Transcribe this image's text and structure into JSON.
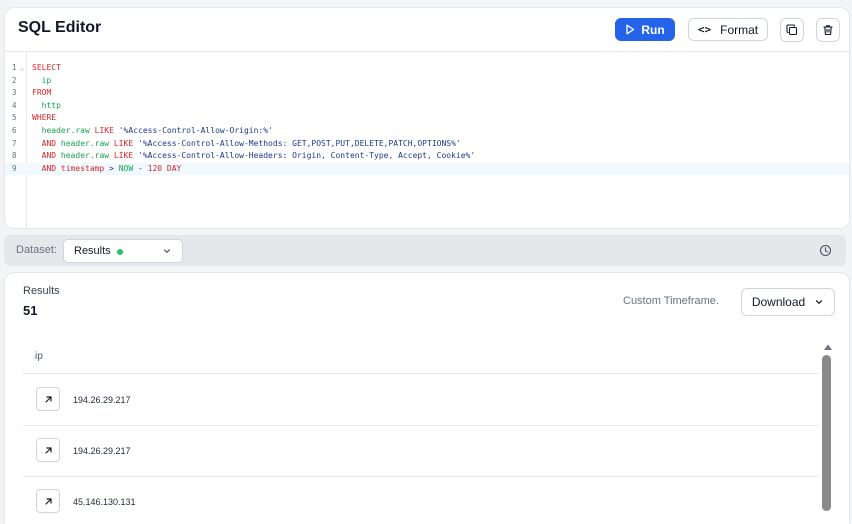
{
  "editor": {
    "title": "SQL Editor",
    "run_label": "Run",
    "format_label": "Format",
    "format_icon": "<>",
    "lines": [
      {
        "num": "1",
        "tokens": [
          {
            "t": "SELECT",
            "c": "kw"
          }
        ]
      },
      {
        "num": "2",
        "tokens": [
          {
            "t": "  ",
            "c": ""
          },
          {
            "t": "ip",
            "c": "id"
          }
        ]
      },
      {
        "num": "3",
        "tokens": [
          {
            "t": "FROM",
            "c": "kw"
          }
        ]
      },
      {
        "num": "4",
        "tokens": [
          {
            "t": "  ",
            "c": ""
          },
          {
            "t": "http",
            "c": "id"
          }
        ]
      },
      {
        "num": "5",
        "tokens": [
          {
            "t": "WHERE",
            "c": "kw"
          }
        ]
      },
      {
        "num": "6",
        "tokens": [
          {
            "t": "  ",
            "c": ""
          },
          {
            "t": "header.raw",
            "c": "id"
          },
          {
            "t": " ",
            "c": ""
          },
          {
            "t": "LIKE",
            "c": "kw"
          },
          {
            "t": " ",
            "c": ""
          },
          {
            "t": "'%Access-Control-Allow-Origin:%'",
            "c": "str"
          }
        ]
      },
      {
        "num": "7",
        "tokens": [
          {
            "t": "  ",
            "c": ""
          },
          {
            "t": "AND",
            "c": "kw"
          },
          {
            "t": " ",
            "c": ""
          },
          {
            "t": "header.raw",
            "c": "id"
          },
          {
            "t": " ",
            "c": ""
          },
          {
            "t": "LIKE",
            "c": "kw"
          },
          {
            "t": " ",
            "c": ""
          },
          {
            "t": "'%Access-Control-Allow-Methods: GET,POST,PUT,DELETE,PATCH,OPTIONS%'",
            "c": "str"
          }
        ]
      },
      {
        "num": "8",
        "tokens": [
          {
            "t": "  ",
            "c": ""
          },
          {
            "t": "AND",
            "c": "kw"
          },
          {
            "t": " ",
            "c": ""
          },
          {
            "t": "header.raw",
            "c": "id"
          },
          {
            "t": " ",
            "c": ""
          },
          {
            "t": "LIKE",
            "c": "kw"
          },
          {
            "t": " ",
            "c": ""
          },
          {
            "t": "'%Access-Control-Allow-Headers: Origin, Content-Type, Accept, Cookie%'",
            "c": "str"
          }
        ]
      },
      {
        "num": "9",
        "tokens": [
          {
            "t": "  ",
            "c": ""
          },
          {
            "t": "AND",
            "c": "kw"
          },
          {
            "t": " ",
            "c": ""
          },
          {
            "t": "timestamp",
            "c": "kw"
          },
          {
            "t": " > ",
            "c": "op"
          },
          {
            "t": "NOW",
            "c": "id"
          },
          {
            "t": " - ",
            "c": "op"
          },
          {
            "t": "120",
            "c": "kw"
          },
          {
            "t": " ",
            "c": ""
          },
          {
            "t": "DAY",
            "c": "kw"
          }
        ]
      }
    ],
    "active_line": "9"
  },
  "dataset": {
    "label": "Dataset:",
    "selected": "Results",
    "status_color": "#22c55e"
  },
  "results": {
    "label": "Results",
    "count": "51",
    "timeframe": "Custom Timeframe.",
    "download_label": "Download",
    "column": "ip",
    "rows": [
      "194.26.29.217",
      "194.26.29.217",
      "45.146.130.131"
    ]
  },
  "colors": {
    "accent": "#2563eb",
    "keyword": "#dc2626",
    "identifier": "#16a34a",
    "string": "#1e3a8a"
  },
  "icons": [
    "play-icon",
    "code-icon",
    "copy-icon",
    "trash-icon",
    "chevron-down-icon",
    "clock-icon",
    "arrow-up-right-icon"
  ]
}
